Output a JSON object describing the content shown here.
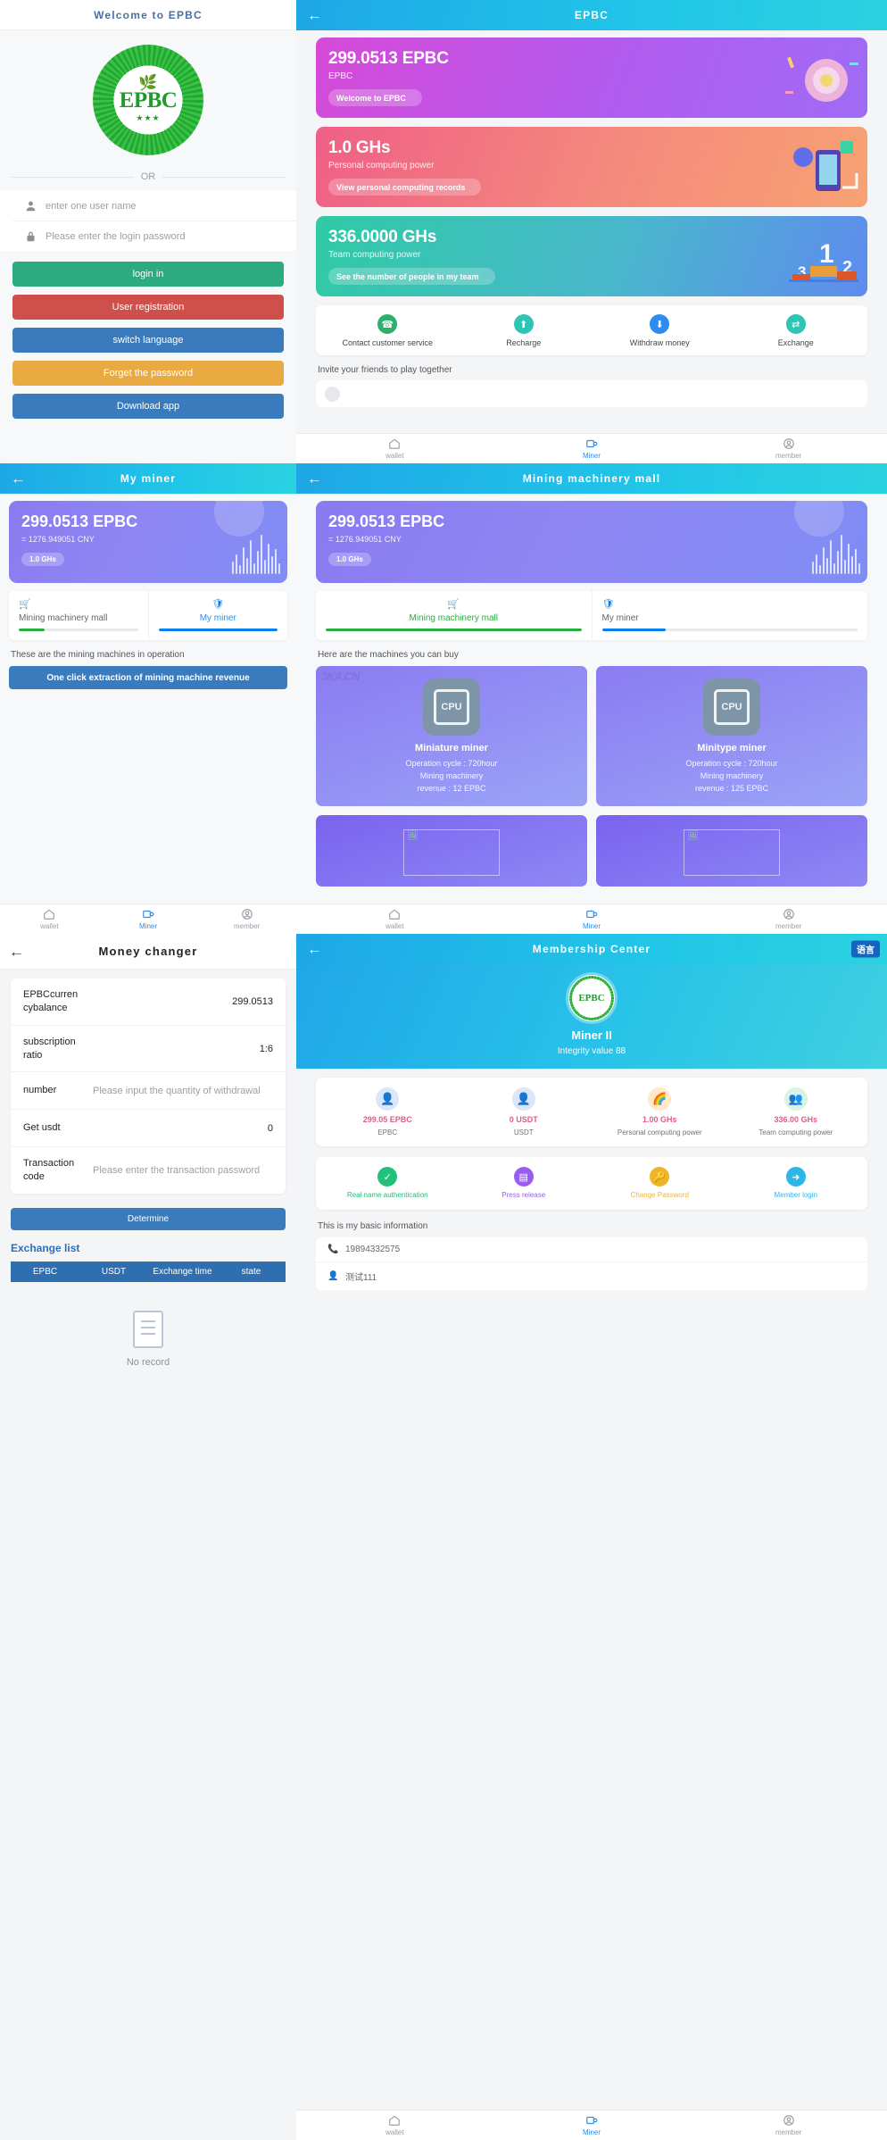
{
  "login": {
    "nav_title": "Welcome to EPBC",
    "logo_text": "EPBC",
    "divider": "OR",
    "username_placeholder": "enter one user name",
    "password_placeholder": "Please enter the login password",
    "buttons": [
      {
        "label": "login in",
        "color": "#2cab81"
      },
      {
        "label": "User registration",
        "color": "#cf4f4a"
      },
      {
        "label": "switch language",
        "color": "#3a7bbd"
      },
      {
        "label": "Forget the password",
        "color": "#e8aa41"
      },
      {
        "label": "Download app",
        "color": "#3a7bbd"
      }
    ]
  },
  "wallet": {
    "nav_title": "EPBC",
    "back_icon": "arrow-left",
    "cards": [
      {
        "value": "299.0513 EPBC",
        "sub": "EPBC",
        "pill": "Welcome to EPBC",
        "color": "#c44fe0"
      },
      {
        "value": "1.0 GHs",
        "sub": "Personal computing power",
        "pill": "View personal computing records",
        "color": "#f0708a"
      },
      {
        "value": "336.0000 GHs",
        "sub": "Team computing power",
        "pill": "See the number of people in my team",
        "color": "#3ac4b0"
      }
    ],
    "quick_actions": [
      {
        "label": "Contact customer service",
        "icon": "headset-icon",
        "color": "#2faf6e"
      },
      {
        "label": "Recharge",
        "icon": "recharge-icon",
        "color": "#2ec4b6"
      },
      {
        "label": "Withdraw money",
        "icon": "withdraw-icon",
        "color": "#2d8cf0"
      },
      {
        "label": "Exchange",
        "icon": "exchange-icon",
        "color": "#2ec4b6"
      }
    ],
    "invite_text": "Invite your friends to play together"
  },
  "tabbar": {
    "items": [
      {
        "label": "wallet",
        "icon": "home-icon"
      },
      {
        "label": "Miner",
        "icon": "miner-icon"
      },
      {
        "label": "member",
        "icon": "user-icon"
      }
    ]
  },
  "my_miner": {
    "nav_title": "My miner",
    "balance": "299.0513 EPBC",
    "cny": "= 1276.949051 CNY",
    "ghs": "1.0 GHs",
    "tabs": [
      {
        "label": "Mining machinery mall",
        "icon": "cart-icon",
        "progress": 22,
        "color": "#27ae3f",
        "active": false
      },
      {
        "label": "My miner",
        "icon": "shield-icon",
        "progress": 100,
        "color": "#0a7ff0",
        "active": true
      }
    ],
    "hint": "These are the mining machines in operation",
    "action_button": "One click extraction of mining machine revenue"
  },
  "mall": {
    "nav_title": "Mining machinery mall",
    "balance": "299.0513 EPBC",
    "cny": "= 1276.949051 CNY",
    "ghs": "1.0 GHs",
    "tabs": [
      {
        "label": "Mining machinery mall",
        "icon": "cart-icon",
        "progress": 100,
        "color": "#27ae3f",
        "active": true
      },
      {
        "label": "My miner",
        "icon": "shield-icon",
        "progress": 25,
        "color": "#0a7ff0",
        "active": false
      }
    ],
    "hint": "Here are the machines you can buy",
    "watermark": "3KA.CN",
    "machines": [
      {
        "name": "Miniature miner",
        "cycle": "Operation cycle : 720hour",
        "revenue_l1": "Mining machinery",
        "revenue_l2": "revenue : 12 EPBC",
        "icon": "cpu-icon"
      },
      {
        "name": "Minitype miner",
        "cycle": "Operation cycle : 720hour",
        "revenue_l1": "Mining machinery",
        "revenue_l2": "revenue : 125 EPBC",
        "icon": "cpu-icon"
      }
    ]
  },
  "money_changer": {
    "nav_title": "Money changer",
    "rows": [
      {
        "label": "EPBCcurren cybalance",
        "value": "299.0513",
        "is_placeholder": false
      },
      {
        "label": "subscription ratio",
        "value": "1:6",
        "is_placeholder": false
      },
      {
        "label": "number",
        "value": "Please input the quantity of withdrawal",
        "is_placeholder": true
      },
      {
        "label": "Get usdt",
        "value": "0",
        "is_placeholder": false
      },
      {
        "label": "Transaction code",
        "value": "Please enter the transaction password",
        "is_placeholder": true
      }
    ],
    "determine_label": "Determine",
    "exchange_list_title": "Exchange list",
    "table_headers": [
      "EPBC",
      "USDT",
      "Exchange time",
      "state"
    ],
    "empty_text": "No record"
  },
  "membership": {
    "nav_title": "Membership Center",
    "lang_button": "语言",
    "logo_text": "EPBC",
    "member_name": "Miner II",
    "integrity": "Integrity value 88",
    "stats": [
      {
        "value": "299.05 EPBC",
        "key": "EPBC",
        "icon": "avatar-coin-icon"
      },
      {
        "value": "0 USDT",
        "key": "USDT",
        "icon": "avatar-usdt-icon"
      },
      {
        "value": "1.00 GHs",
        "key": "Personal computing power",
        "icon": "rainbow-icon",
        "color": "#e05b8a"
      },
      {
        "value": "336.00 GHs",
        "key": "Team computing power",
        "icon": "team-icon",
        "color": "#e05b8a"
      }
    ],
    "actions": [
      {
        "label": "Real name authentication",
        "icon": "shield-check-icon",
        "color": "#22c07a"
      },
      {
        "label": "Press release",
        "icon": "news-icon",
        "color": "#9b5cf0"
      },
      {
        "label": "Change Password",
        "icon": "key-icon",
        "color": "#f0b429"
      },
      {
        "label": "Member login",
        "icon": "login-icon",
        "color": "#2bb8e8"
      }
    ],
    "basic_title": "This is my basic information",
    "basic_rows": [
      {
        "icon": "phone-icon",
        "value": "19894332575"
      },
      {
        "icon": "user-icon",
        "value": "测试111"
      }
    ]
  }
}
